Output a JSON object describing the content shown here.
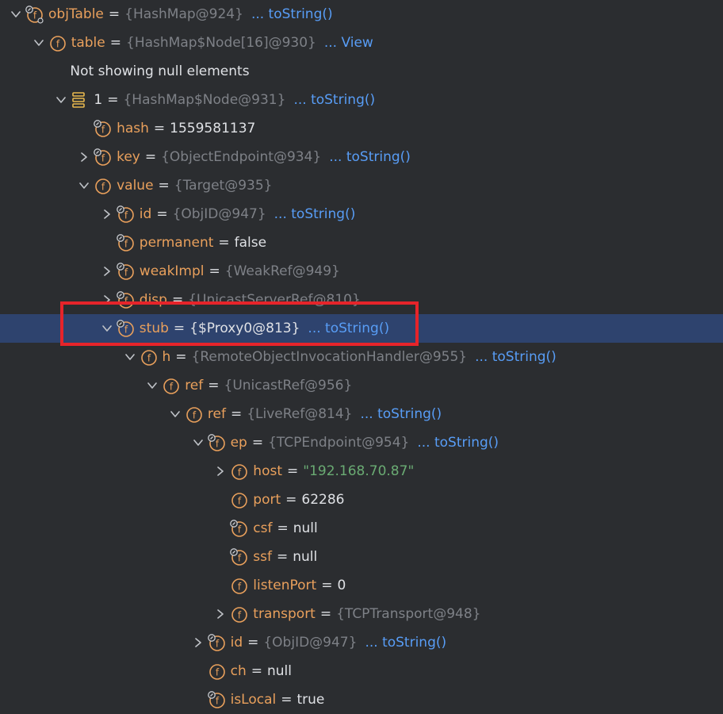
{
  "rows": [
    {
      "indent": 0,
      "chev": "down",
      "icon": "field-static",
      "name": "objTable",
      "type": "{HashMap@924}",
      "link": "... toString()"
    },
    {
      "indent": 1,
      "chev": "down",
      "icon": "field",
      "name": "table",
      "type": "{HashMap$Node[16]@930}",
      "link": "... View"
    },
    {
      "indent": 2,
      "chev": "none",
      "icon": "none",
      "plain": "Not showing null elements"
    },
    {
      "indent": 2,
      "chev": "down",
      "icon": "array",
      "index": "1",
      "type": "{HashMap$Node@931}",
      "link": "... toString()"
    },
    {
      "indent": 3,
      "chev": "none",
      "icon": "field-final",
      "name": "hash",
      "value": "1559581137"
    },
    {
      "indent": 3,
      "chev": "right",
      "icon": "field-final",
      "name": "key",
      "type": "{ObjectEndpoint@934}",
      "link": "... toString()"
    },
    {
      "indent": 3,
      "chev": "down",
      "icon": "field",
      "name": "value",
      "type": "{Target@935}"
    },
    {
      "indent": 4,
      "chev": "right",
      "icon": "field-final",
      "name": "id",
      "type": "{ObjID@947}",
      "link": "... toString()"
    },
    {
      "indent": 4,
      "chev": "none",
      "icon": "field-final",
      "name": "permanent",
      "value": "false"
    },
    {
      "indent": 4,
      "chev": "right",
      "icon": "field-final",
      "name": "weakImpl",
      "type": "{WeakRef@949}"
    },
    {
      "indent": 4,
      "chev": "right",
      "icon": "field-final",
      "name": "disp",
      "type": "{UnicastServerRef@810}"
    },
    {
      "indent": 4,
      "chev": "down",
      "icon": "field-final",
      "name": "stub",
      "value": "{$Proxy0@813}",
      "link": "... toString()",
      "selected": true
    },
    {
      "indent": 5,
      "chev": "down",
      "icon": "field",
      "name": "h",
      "type": "{RemoteObjectInvocationHandler@955}",
      "link": "... toString()"
    },
    {
      "indent": 6,
      "chev": "down",
      "icon": "field",
      "name": "ref",
      "type": "{UnicastRef@956}"
    },
    {
      "indent": 7,
      "chev": "down",
      "icon": "field",
      "name": "ref",
      "type": "{LiveRef@814}",
      "link": "... toString()"
    },
    {
      "indent": 8,
      "chev": "down",
      "icon": "field-final",
      "name": "ep",
      "type": "{TCPEndpoint@954}",
      "link": "... toString()"
    },
    {
      "indent": 9,
      "chev": "right",
      "icon": "field",
      "name": "host",
      "string": "\"192.168.70.87\""
    },
    {
      "indent": 9,
      "chev": "none",
      "icon": "field",
      "name": "port",
      "value": "62286"
    },
    {
      "indent": 9,
      "chev": "none",
      "icon": "field-final",
      "name": "csf",
      "value": "null"
    },
    {
      "indent": 9,
      "chev": "none",
      "icon": "field-final",
      "name": "ssf",
      "value": "null"
    },
    {
      "indent": 9,
      "chev": "none",
      "icon": "field",
      "name": "listenPort",
      "value": "0"
    },
    {
      "indent": 9,
      "chev": "right",
      "icon": "field",
      "name": "transport",
      "type": "{TCPTransport@948}"
    },
    {
      "indent": 8,
      "chev": "right",
      "icon": "field-final",
      "name": "id",
      "type": "{ObjID@947}",
      "link": "... toString()"
    },
    {
      "indent": 8,
      "chev": "none",
      "icon": "field",
      "name": "ch",
      "value": "null"
    },
    {
      "indent": 8,
      "chev": "none",
      "icon": "field-final",
      "name": "isLocal",
      "value": "true"
    }
  ]
}
